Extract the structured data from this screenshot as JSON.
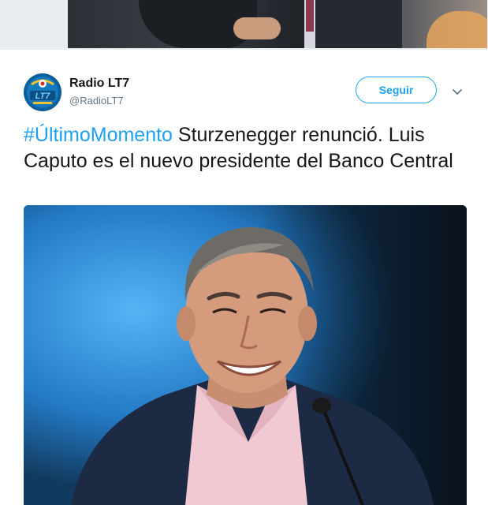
{
  "tweet": {
    "display_name": "Radio LT7",
    "handle": "@RadioLT7",
    "follow_label": "Seguir",
    "hashtag": "#ÚltimoMomento",
    "text_rest": " Sturzenegger renunció. Luis Caputo es el nuevo presidente del Banco Central",
    "avatar_text": "LT7",
    "icons": {
      "more": "chevron-down-icon"
    }
  },
  "colors": {
    "accent": "#1da1f2",
    "text": "#14171a",
    "muted": "#657786"
  }
}
